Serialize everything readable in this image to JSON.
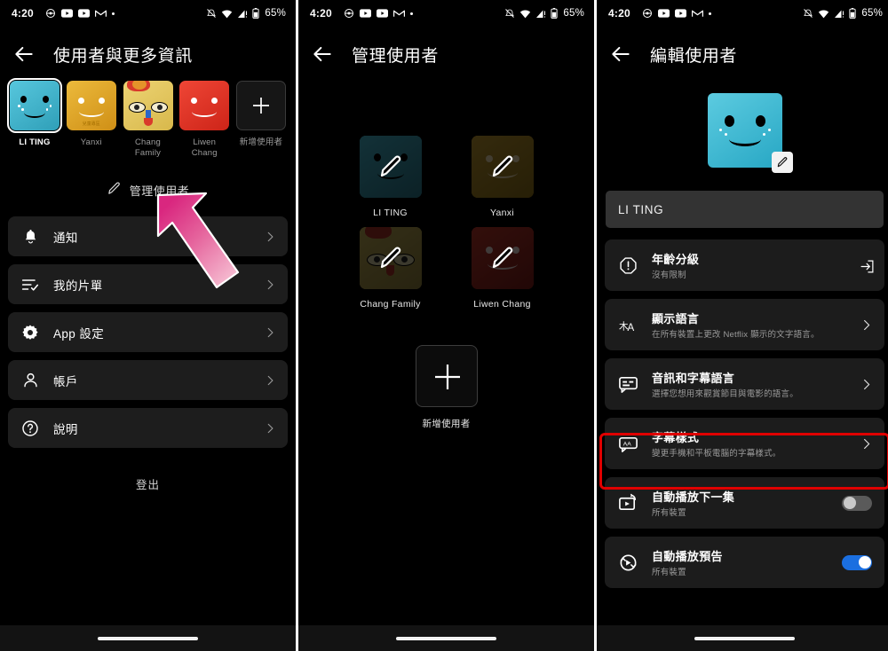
{
  "status_bar": {
    "time": "4:20",
    "left_icons": [
      "helmet-icon",
      "youtube-icon",
      "youtube-icon",
      "gmail-icon",
      "dot-icon"
    ],
    "right_icons": [
      "mute-icon",
      "wifi-icon",
      "signal-icon",
      "battery-icon"
    ],
    "battery": "65%"
  },
  "screen1": {
    "title": "使用者與更多資訊",
    "profiles": [
      {
        "name": "LI TING",
        "selected": true,
        "color": "#3fb6cf",
        "kids": false
      },
      {
        "name": "Yanxi",
        "selected": false,
        "color": "#e0a72b",
        "kids": true,
        "kids_label": "兒童專區"
      },
      {
        "name": "Chang Family",
        "selected": false,
        "color": "#e8c96b",
        "kids": false
      },
      {
        "name": "Liwen Chang",
        "selected": false,
        "color": "#e23b2e",
        "kids": false
      }
    ],
    "add_profile_label": "新增使用者",
    "manage_label": "管理使用者",
    "manage_icon": "pencil-icon",
    "menu": [
      {
        "label": "通知",
        "icon": "bell-icon"
      },
      {
        "label": "我的片單",
        "icon": "checklist-icon"
      },
      {
        "label": "App 設定",
        "icon": "gear-icon"
      },
      {
        "label": "帳戶",
        "icon": "person-icon"
      },
      {
        "label": "說明",
        "icon": "question-circle-icon"
      }
    ],
    "sign_out_label": "登出",
    "annotation": {
      "type": "arrow",
      "color": "#e4418a",
      "points_to": "管理使用者"
    }
  },
  "screen2": {
    "title": "管理使用者",
    "profiles": [
      {
        "name": "LI TING",
        "color": "#2a6b79"
      },
      {
        "name": "Yanxi",
        "color": "#6b5516"
      },
      {
        "name": "Chang Family",
        "color": "#6e6332"
      },
      {
        "name": "Liwen Chang",
        "color": "#6b1f19"
      }
    ],
    "edit_overlay_icon": "pencil-icon",
    "add_profile_label": "新增使用者",
    "add_profile_icon": "plus-icon"
  },
  "screen3": {
    "title": "編輯使用者",
    "avatar_edit_icon": "pencil-icon",
    "profile_name_value": "LI TING",
    "rows": [
      {
        "title": "年齡分級",
        "subtitle": "沒有限制",
        "icon": "alert-octagon-icon",
        "trailing": "external-link-icon",
        "highlighted": false
      },
      {
        "title": "顯示語言",
        "subtitle": "在所有裝置上更改 Netflix 顯示的文字語言。",
        "icon": "translate-icon",
        "trailing": "chevron-right-icon",
        "highlighted": false
      },
      {
        "title": "音訊和字幕語言",
        "subtitle": "選擇您想用來觀賞節目與電影的語言。",
        "icon": "subtitles-icon",
        "trailing": "chevron-right-icon",
        "highlighted": false
      },
      {
        "title": "字幕樣式",
        "subtitle": "變更手機和平板電腦的字幕樣式。",
        "icon": "caption-style-icon",
        "trailing": "chevron-right-icon",
        "highlighted": false
      },
      {
        "title": "自動播放下一集",
        "subtitle": "所有裝置",
        "icon": "autoplay-next-icon",
        "trailing": "toggle-off",
        "highlighted": true
      },
      {
        "title": "自動播放預告",
        "subtitle": "所有裝置",
        "icon": "autoplay-preview-icon",
        "trailing": "toggle-on",
        "highlighted": false
      }
    ],
    "highlight_color": "#e00000",
    "toggle_on_color": "#1b6fe0"
  }
}
